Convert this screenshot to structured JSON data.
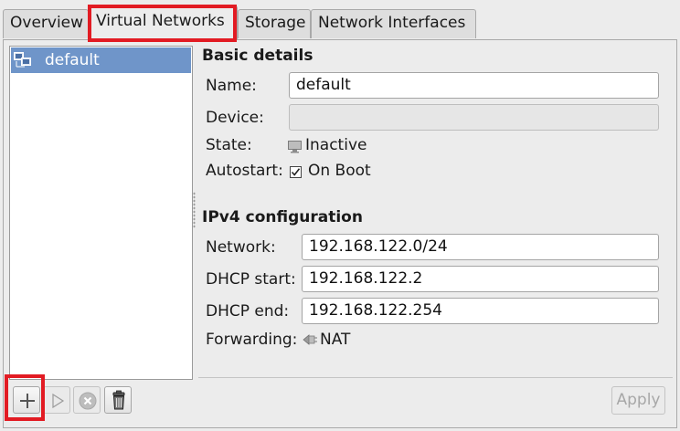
{
  "tabs": [
    {
      "label": "Overview"
    },
    {
      "label": "Virtual Networks"
    },
    {
      "label": "Storage"
    },
    {
      "label": "Network Interfaces"
    }
  ],
  "network_list": {
    "items": [
      {
        "label": "default",
        "icon": "network-icon",
        "selected": true
      }
    ]
  },
  "basic_details": {
    "heading": "Basic details",
    "name_label": "Name:",
    "name_value": "default",
    "device_label": "Device:",
    "device_value": "",
    "state_label": "State:",
    "state_value": "Inactive",
    "autostart_label": "Autostart:",
    "autostart_value": "On Boot",
    "autostart_checked": true
  },
  "ipv4": {
    "heading": "IPv4 configuration",
    "network_label": "Network:",
    "network_value": "192.168.122.0/24",
    "dhcp_start_label": "DHCP start:",
    "dhcp_start_value": "192.168.122.2",
    "dhcp_end_label": "DHCP end:",
    "dhcp_end_value": "192.168.122.254",
    "forwarding_label": "Forwarding:",
    "forwarding_value": "NAT"
  },
  "toolbar": {
    "add_icon": "plus-icon",
    "start_icon": "play-icon",
    "stop_icon": "stop-icon",
    "delete_icon": "trash-icon",
    "apply_label": "Apply",
    "apply_enabled": false
  },
  "colors": {
    "highlight_box": "#e21b23",
    "selection": "#6f95c9"
  }
}
